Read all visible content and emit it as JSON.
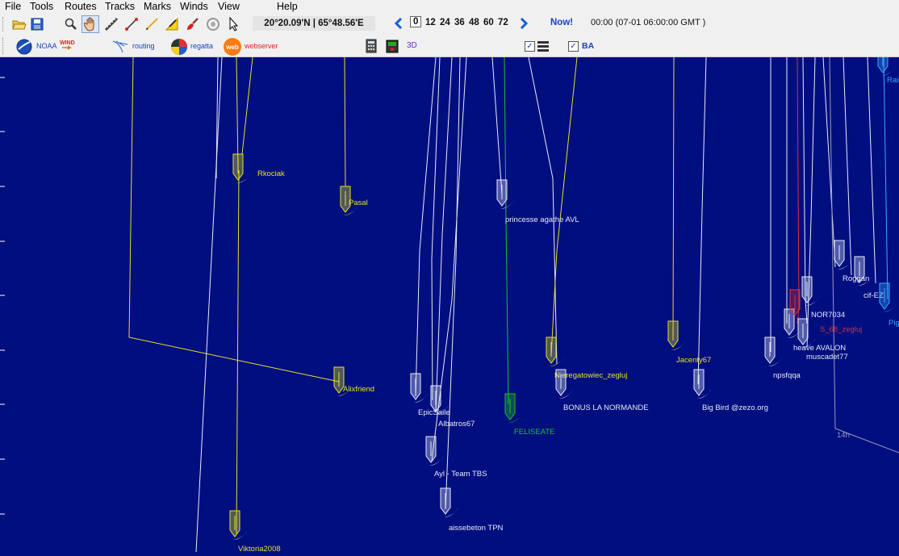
{
  "menu": [
    "File",
    "Tools",
    "Routes",
    "Tracks",
    "Marks",
    "Winds",
    "View",
    "Help"
  ],
  "toolbar": {
    "coordinates": "20°20.09'N | 65°48.56'E",
    "hours": [
      "0",
      "12",
      "24",
      "36",
      "48",
      "60",
      "72"
    ],
    "now_label": "Now!",
    "time_text": "00:00 (07-01 06:00:00 GMT )"
  },
  "toolbar2": {
    "noaa_label": "NOAA",
    "wind_label": "WIND",
    "routing_label": "routing",
    "regatta_label": "regatta",
    "web_label": "web",
    "webserver_label": "webserver",
    "threed_label": "3D",
    "ba_label": "BA"
  },
  "map": {
    "boats": [
      {
        "name": "Rkociak",
        "color": "yellow"
      },
      {
        "name": "Pasal",
        "color": "yellow"
      },
      {
        "name": "princesse agathe AVL",
        "color": "white"
      },
      {
        "name": "Alixfriend",
        "color": "yellow"
      },
      {
        "name": "EpicSaile",
        "color": "white"
      },
      {
        "name": "Albatros67",
        "color": "white"
      },
      {
        "name": "FELISEATE",
        "color": "green"
      },
      {
        "name": "Nieregatowiec_zegluj",
        "color": "yellow"
      },
      {
        "name": "BONUS LA NORMANDE",
        "color": "white"
      },
      {
        "name": "Jacenty67",
        "color": "yellow"
      },
      {
        "name": "Big Bird @zezo.org",
        "color": "white"
      },
      {
        "name": "Ayl - Team TBS",
        "color": "white"
      },
      {
        "name": "aissebeton TPN",
        "color": "white"
      },
      {
        "name": "Viktoria2008",
        "color": "yellow"
      },
      {
        "name": "npsfqqa",
        "color": "white"
      },
      {
        "name": "heave AVALON",
        "color": "white"
      },
      {
        "name": "muscadet77",
        "color": "white"
      },
      {
        "name": "NOR7034",
        "color": "white"
      },
      {
        "name": "S_68_zegluj",
        "color": "red"
      },
      {
        "name": "Roggan",
        "color": "white"
      },
      {
        "name": "cif-EZ",
        "color": "white"
      },
      {
        "name": "Raid",
        "color": "cyan"
      },
      {
        "name": "Pig",
        "color": "cyan"
      }
    ],
    "track_marker": "14h"
  },
  "colors": {
    "sea": "#000e80",
    "yellow": "#e6e020",
    "white": "#e8eaf5",
    "green": "#20c020",
    "red": "#e03030",
    "cyan": "#3aa8ff"
  }
}
